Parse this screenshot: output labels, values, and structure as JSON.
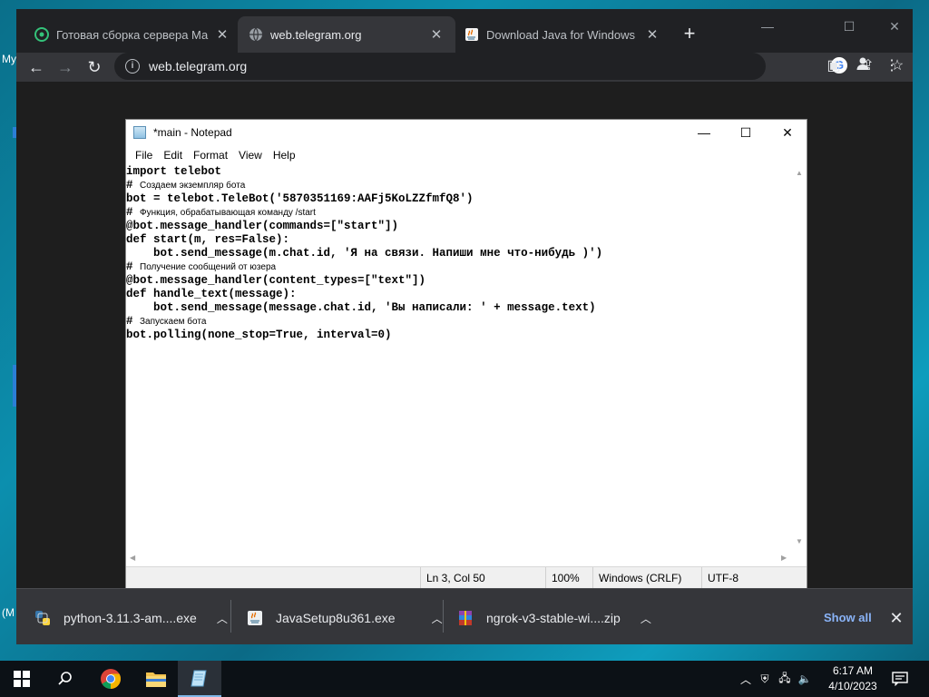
{
  "desktop": {
    "edge_labels": [
      "My",
      "(M"
    ]
  },
  "browser": {
    "tabs": [
      {
        "title": "Готовая сборка сервера Майнк",
        "active": false
      },
      {
        "title": "web.telegram.org",
        "active": true
      },
      {
        "title": "Download Java for Windows",
        "active": false
      }
    ],
    "new_tab_symbol": "+",
    "window_controls": {
      "minimize": "—",
      "maximize": "☐",
      "close": "✕"
    },
    "url": "web.telegram.org"
  },
  "notepad": {
    "title": "*main - Notepad",
    "menu": [
      "File",
      "Edit",
      "Format",
      "View",
      "Help"
    ],
    "lines": [
      {
        "code": "import telebot",
        "comment": ""
      },
      {
        "code": "# ",
        "comment": "Создаем экземпляр бота"
      },
      {
        "code": "bot = telebot.TeleBot('5870351169:AAFj5KoLZZfmfQ8')",
        "comment": ""
      },
      {
        "code": "# ",
        "comment": "Функция, обрабатывающая команду /start"
      },
      {
        "code": "@bot.message_handler(commands=[\"start\"])",
        "comment": ""
      },
      {
        "code": "def start(m, res=False):",
        "comment": ""
      },
      {
        "code": "    bot.send_message(m.chat.id, 'Я на связи. Напиши мне что-нибудь )')",
        "comment": ""
      },
      {
        "code": "# ",
        "comment": "Получение сообщений от юзера"
      },
      {
        "code": "@bot.message_handler(content_types=[\"text\"])",
        "comment": ""
      },
      {
        "code": "def handle_text(message):",
        "comment": ""
      },
      {
        "code": "    bot.send_message(message.chat.id, 'Вы написали: ' + message.text)",
        "comment": ""
      },
      {
        "code": "# ",
        "comment": "Запускаем бота"
      },
      {
        "code": "bot.polling(none_stop=True, interval=0)",
        "comment": ""
      }
    ],
    "status": {
      "position": "Ln 3, Col 50",
      "zoom": "100%",
      "line_ending": "Windows (CRLF)",
      "encoding": "UTF-8"
    }
  },
  "downloads": {
    "items": [
      {
        "name": "python-3.11.3-am....exe",
        "icon": "python-installer-icon"
      },
      {
        "name": "JavaSetup8u361.exe",
        "icon": "java-installer-icon"
      },
      {
        "name": "ngrok-v3-stable-wi....zip",
        "icon": "winrar-archive-icon"
      }
    ],
    "show_all": "Show all",
    "close": "✕"
  },
  "taskbar": {
    "time": "6:17 AM",
    "date": "4/10/2023",
    "chrome_icon": "chrome-icon",
    "explorer_icon": "file-explorer-icon",
    "notepad_icon": "notepad-icon"
  }
}
